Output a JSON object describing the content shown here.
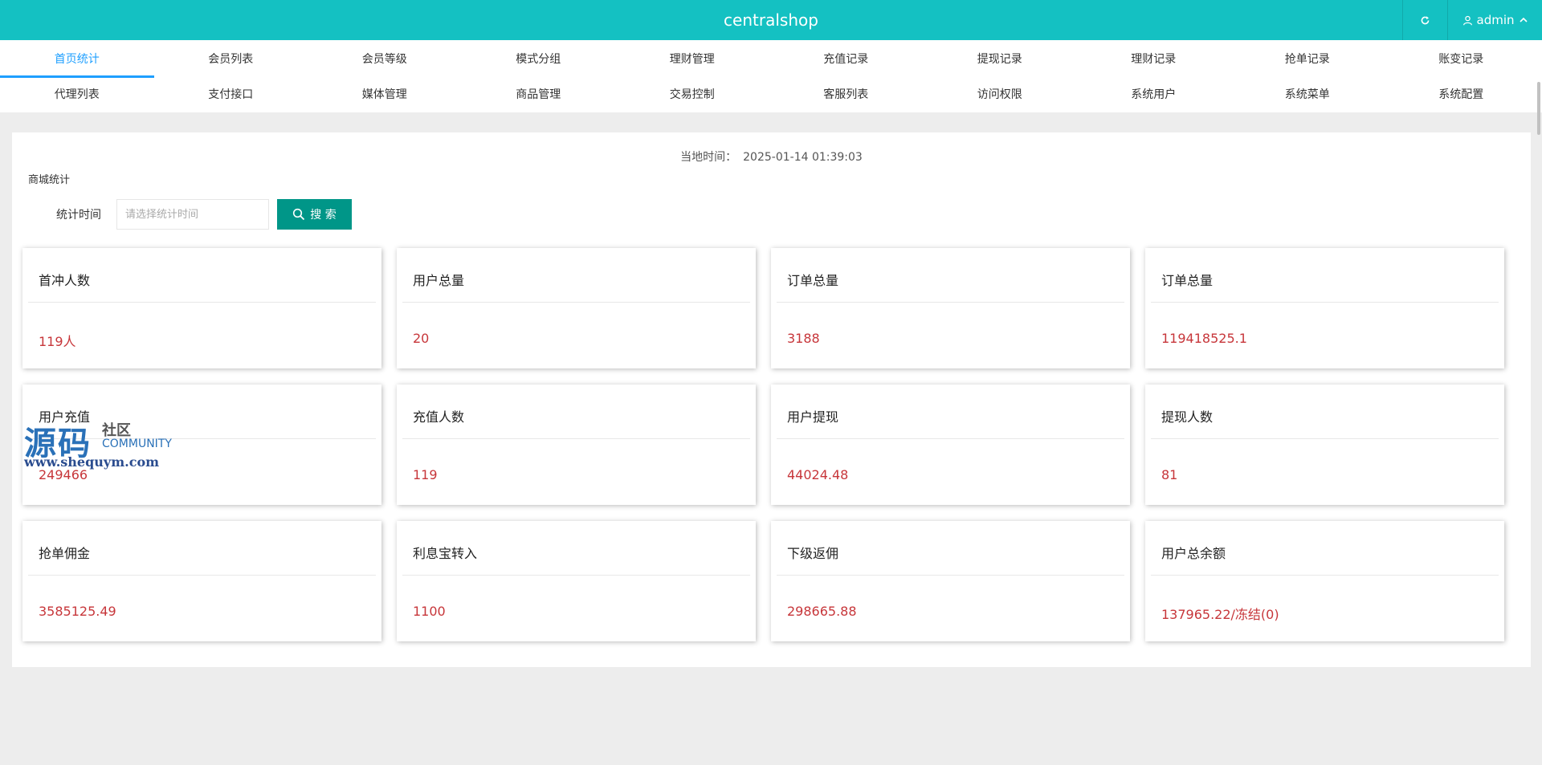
{
  "header": {
    "brand": "centralshop",
    "user": "admin"
  },
  "nav": {
    "row1": [
      "首页统计",
      "会员列表",
      "会员等级",
      "模式分组",
      "理财管理",
      "充值记录",
      "提现记录",
      "理财记录",
      "抢单记录",
      "账变记录"
    ],
    "row2": [
      "代理列表",
      "支付接口",
      "媒体管理",
      "商品管理",
      "交易控制",
      "客服列表",
      "访问权限",
      "系统用户",
      "系统菜单",
      "系统配置"
    ],
    "active": "首页统计"
  },
  "main": {
    "local_time_label": "当地时间：",
    "local_time": "2025-01-14 01:39:03",
    "section_title": "商城统计",
    "filter_label": "统计时间",
    "filter_placeholder": "请选择统计时间",
    "search_label": "搜 索"
  },
  "stats": [
    {
      "title": "首冲人数",
      "value": "119人"
    },
    {
      "title": "用户总量",
      "value": "20"
    },
    {
      "title": "订单总量",
      "value": "3188"
    },
    {
      "title": "订单总量",
      "value": "119418525.1"
    },
    {
      "title": "用户充值",
      "value": "249466"
    },
    {
      "title": "充值人数",
      "value": "119"
    },
    {
      "title": "用户提现",
      "value": "44024.48"
    },
    {
      "title": "提现人数",
      "value": "81"
    },
    {
      "title": "抢单佣金",
      "value": "3585125.49"
    },
    {
      "title": "利息宝转入",
      "value": "1100"
    },
    {
      "title": "下级返佣",
      "value": "298665.88"
    },
    {
      "title": "用户总余额",
      "value": "137965.22/冻结(0)"
    }
  ],
  "watermark": {
    "cn": "源码",
    "sq": "社区",
    "community": "COMMUNITY",
    "url": "www.shequym.com"
  },
  "colors": {
    "header_bg": "#14c1c2",
    "active_tab": "#1e9fff",
    "search_btn": "#009688",
    "value_text": "#c7363a"
  },
  "icons": {
    "refresh": "refresh-icon",
    "user": "user-icon",
    "chevron": "chevron-up-icon",
    "search": "search-icon"
  }
}
